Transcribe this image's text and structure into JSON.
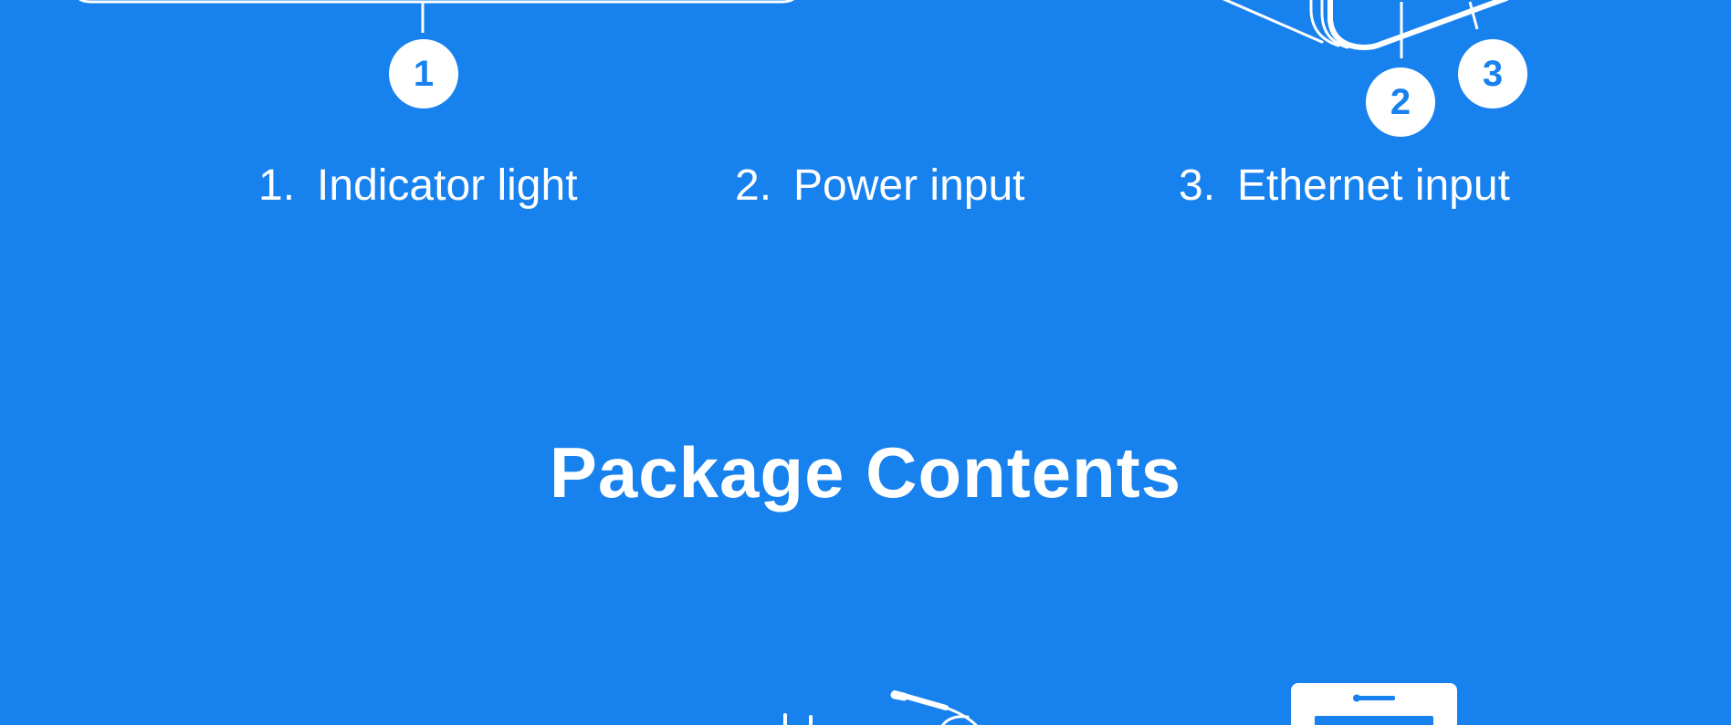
{
  "callouts": [
    {
      "number": "1",
      "label_number": "1.",
      "label_text": "Indicator light"
    },
    {
      "number": "2",
      "label_number": "2.",
      "label_text": "Power input"
    },
    {
      "number": "3",
      "label_number": "3.",
      "label_text": "Ethernet input"
    }
  ],
  "package_contents": {
    "title": "Package Contents"
  },
  "colors": {
    "background": "#1781ee",
    "foreground": "#ffffff"
  },
  "icons": {
    "device_top_left": "device-outline-icon",
    "device_top_right": "device-ports-icon",
    "cable": "power-cable-icon",
    "adapter": "power-adapter-icon"
  }
}
